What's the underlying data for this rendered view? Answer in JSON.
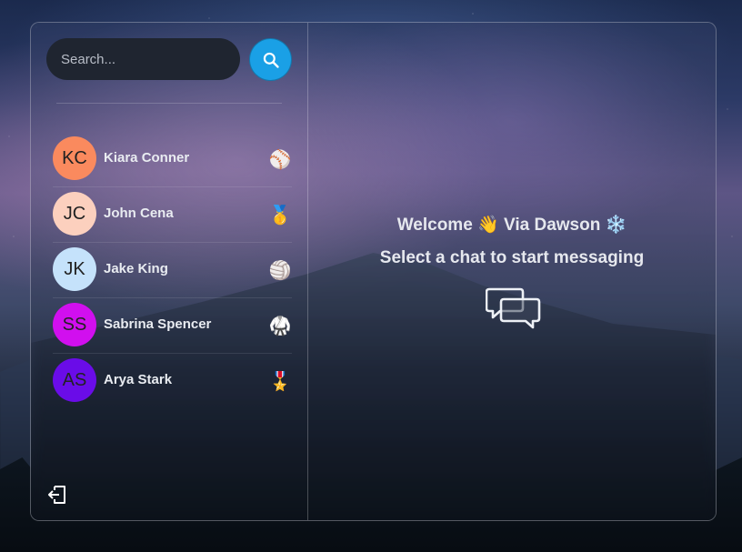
{
  "search": {
    "placeholder": "Search...",
    "button_icon": "search-icon"
  },
  "contacts": [
    {
      "initials": "KC",
      "name": "Kiara Conner",
      "avatar_color": "#fa8a5e",
      "badge_icon": "baseball-icon",
      "badge": "⚾"
    },
    {
      "initials": "JC",
      "name": "John Cena",
      "avatar_color": "#fcd0be",
      "badge_icon": "medal-icon",
      "badge": "🥇"
    },
    {
      "initials": "JK",
      "name": "Jake King",
      "avatar_color": "#c5e2fb",
      "badge_icon": "volleyball-icon",
      "badge": "🏐"
    },
    {
      "initials": "SS",
      "name": "Sabrina Spencer",
      "avatar_color": "#d10fef",
      "badge_icon": "martial-arts-uniform-icon",
      "badge": "🥋"
    },
    {
      "initials": "AS",
      "name": "Arya Stark",
      "avatar_color": "#6a0ce8",
      "badge_icon": "military-medal-icon",
      "badge": "🎖️"
    }
  ],
  "main": {
    "welcome_prefix": "Welcome",
    "wave_emoji": "👋",
    "user_name": "Via Dawson",
    "snowflake_emoji": "❄️",
    "subtitle": "Select a chat to start messaging",
    "icon": "chat-bubbles-icon"
  },
  "sidebar": {
    "logout_icon": "logout-icon"
  },
  "colors": {
    "search_button": "#1aa0e6",
    "search_input_bg": "#1f2530",
    "text": "#e9ecf1"
  }
}
